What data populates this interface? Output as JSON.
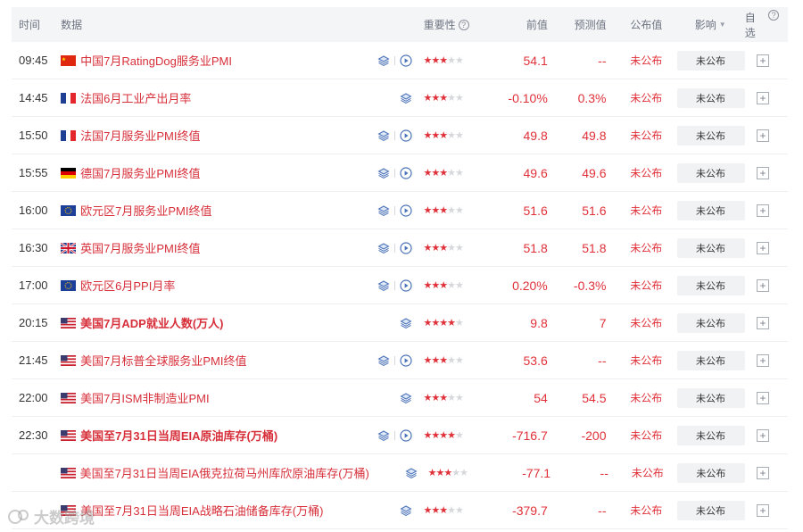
{
  "header": {
    "time": "时间",
    "data": "数据",
    "importance": "重要性",
    "importance_help": "?",
    "previous": "前值",
    "forecast": "预测值",
    "published": "公布值",
    "impact": "影响",
    "watchlist": "自选",
    "watchlist_help": "?"
  },
  "rows": [
    {
      "time": "09:45",
      "flag": "cn",
      "event": "中国7月RatingDog服务业PMI",
      "bold": false,
      "play": true,
      "stars": 3,
      "prev": "54.1",
      "forecast": "--",
      "published": "未公布",
      "impact": "未公布"
    },
    {
      "time": "14:45",
      "flag": "fr",
      "event": "法国6月工业产出月率",
      "bold": false,
      "play": false,
      "stars": 3,
      "prev": "-0.10%",
      "forecast": "0.3%",
      "published": "未公布",
      "impact": "未公布"
    },
    {
      "time": "15:50",
      "flag": "fr",
      "event": "法国7月服务业PMI终值",
      "bold": false,
      "play": true,
      "stars": 3,
      "prev": "49.8",
      "forecast": "49.8",
      "published": "未公布",
      "impact": "未公布"
    },
    {
      "time": "15:55",
      "flag": "de",
      "event": "德国7月服务业PMI终值",
      "bold": false,
      "play": true,
      "stars": 3,
      "prev": "49.6",
      "forecast": "49.6",
      "published": "未公布",
      "impact": "未公布"
    },
    {
      "time": "16:00",
      "flag": "eu",
      "event": "欧元区7月服务业PMI终值",
      "bold": false,
      "play": true,
      "stars": 3,
      "prev": "51.6",
      "forecast": "51.6",
      "published": "未公布",
      "impact": "未公布"
    },
    {
      "time": "16:30",
      "flag": "gb",
      "event": "英国7月服务业PMI终值",
      "bold": false,
      "play": true,
      "stars": 3,
      "prev": "51.8",
      "forecast": "51.8",
      "published": "未公布",
      "impact": "未公布"
    },
    {
      "time": "17:00",
      "flag": "eu",
      "event": "欧元区6月PPI月率",
      "bold": false,
      "play": true,
      "stars": 3,
      "prev": "0.20%",
      "forecast": "-0.3%",
      "published": "未公布",
      "impact": "未公布"
    },
    {
      "time": "20:15",
      "flag": "us",
      "event": "美国7月ADP就业人数(万人)",
      "bold": true,
      "play": false,
      "stars": 4,
      "prev": "9.8",
      "forecast": "7",
      "published": "未公布",
      "impact": "未公布"
    },
    {
      "time": "21:45",
      "flag": "us",
      "event": "美国7月标普全球服务业PMI终值",
      "bold": false,
      "play": true,
      "stars": 3,
      "prev": "53.6",
      "forecast": "--",
      "published": "未公布",
      "impact": "未公布"
    },
    {
      "time": "22:00",
      "flag": "us",
      "event": "美国7月ISM非制造业PMI",
      "bold": false,
      "play": false,
      "stars": 3,
      "prev": "54",
      "forecast": "54.5",
      "published": "未公布",
      "impact": "未公布"
    },
    {
      "time": "22:30",
      "flag": "us",
      "event": "美国至7月31日当周EIA原油库存(万桶)",
      "bold": true,
      "play": true,
      "stars": 4,
      "prev": "-716.7",
      "forecast": "-200",
      "published": "未公布",
      "impact": "未公布"
    },
    {
      "time": "",
      "flag": "us",
      "event": "美国至7月31日当周EIA俄克拉荷马州库欣原油库存(万桶)",
      "bold": false,
      "play": false,
      "stars": 3,
      "prev": "-77.1",
      "forecast": "--",
      "published": "未公布",
      "impact": "未公布"
    },
    {
      "time": "",
      "flag": "us",
      "event": "美国至7月31日当周EIA战略石油储备库存(万桶)",
      "bold": false,
      "play": false,
      "stars": 3,
      "prev": "-379.7",
      "forecast": "--",
      "published": "未公布",
      "impact": "未公布"
    }
  ],
  "watermark": "大数跨境",
  "colors": {
    "accent_red": "#e0313a",
    "header_bg": "#f4f5f7",
    "button_bg": "#f1f2f4"
  }
}
